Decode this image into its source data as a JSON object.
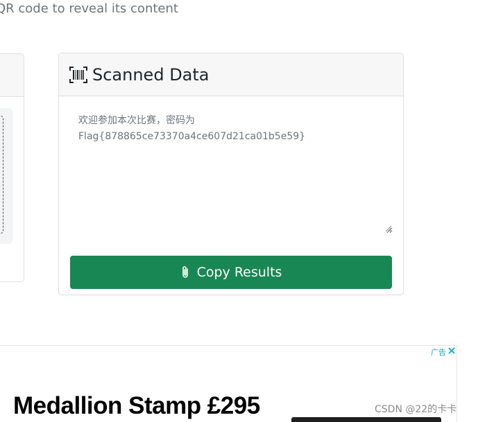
{
  "page": {
    "subtitle": "QR code to reveal its content"
  },
  "scanned_card": {
    "title": "Scanned Data",
    "icon": "barcode-scan-icon",
    "result_text": "欢迎参加本次比赛，密码为\nFlag{878865ce73370a4ce607d21ca01b5e59}",
    "copy_button_label": "Copy Results",
    "copy_button_icon": "paperclip-icon"
  },
  "ad": {
    "label": "广告",
    "headline": "Medallion Stamp £295"
  },
  "watermark": "CSDN @22的卡卡",
  "colors": {
    "copy_button": "#198754",
    "card_header_bg": "#f7f7f7",
    "ad_label": "#00aecd"
  }
}
